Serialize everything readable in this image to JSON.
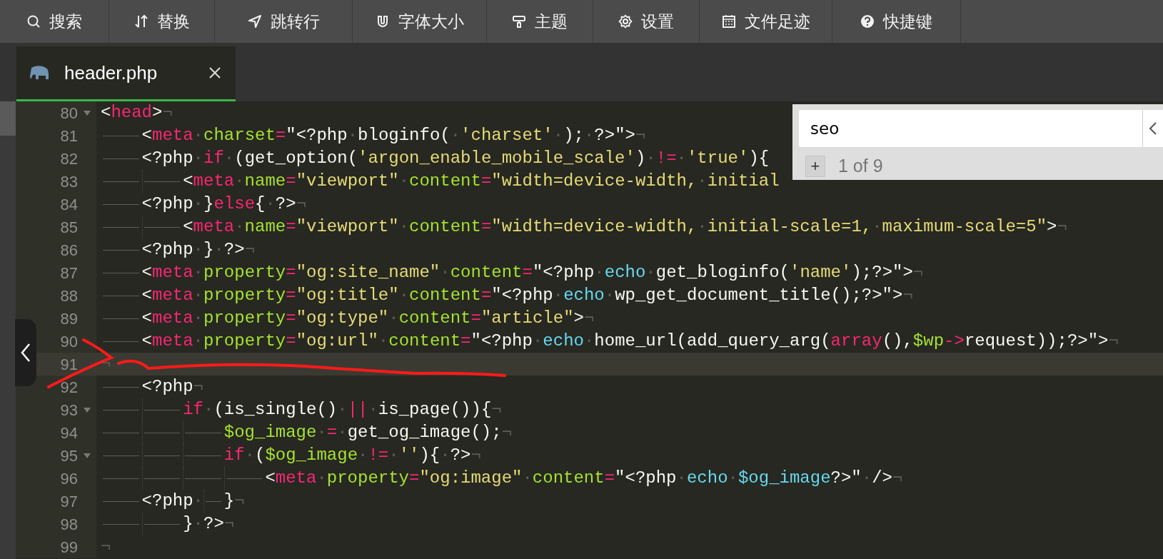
{
  "toolbar": [
    {
      "label": "搜索"
    },
    {
      "label": "替换"
    },
    {
      "label": "跳转行"
    },
    {
      "label": "字体大小"
    },
    {
      "label": "主题"
    },
    {
      "label": "设置"
    },
    {
      "label": "文件足迹"
    },
    {
      "label": "快捷键"
    }
  ],
  "tabs": [
    {
      "label": "header.php",
      "selected": true
    }
  ],
  "search_panel": {
    "value": "seo",
    "add_button": "+",
    "match_count": "1 of 9"
  },
  "editor": {
    "lines": [
      {
        "number": "80",
        "foldable": true,
        "active": false,
        "tokens": [
          {
            "kind": "plain",
            "text": "<"
          },
          {
            "kind": "tag",
            "text": "head"
          },
          {
            "kind": "plain",
            "text": ">"
          },
          {
            "kind": "eol",
            "text": "¬"
          }
        ]
      },
      {
        "number": "81",
        "foldable": false,
        "active": false,
        "tokens": [
          {
            "kind": "tab"
          },
          {
            "kind": "plain",
            "text": "<"
          },
          {
            "kind": "tag",
            "text": "meta"
          },
          {
            "kind": "space",
            "text": "·"
          },
          {
            "kind": "attr",
            "text": "charset"
          },
          {
            "kind": "tag",
            "text": "="
          },
          {
            "kind": "plain",
            "text": "\"<?php"
          },
          {
            "kind": "space",
            "text": "·"
          },
          {
            "kind": "plain",
            "text": "bloginfo("
          },
          {
            "kind": "space",
            "text": "·"
          },
          {
            "kind": "string",
            "text": "'charset'"
          },
          {
            "kind": "space",
            "text": "·"
          },
          {
            "kind": "plain",
            "text": ");"
          },
          {
            "kind": "space",
            "text": "·"
          },
          {
            "kind": "plain",
            "text": "?>\">"
          },
          {
            "kind": "eol",
            "text": "¬"
          }
        ]
      },
      {
        "number": "82",
        "foldable": false,
        "active": false,
        "tokens": [
          {
            "kind": "tab"
          },
          {
            "kind": "plain",
            "text": "<?php"
          },
          {
            "kind": "space",
            "text": "·"
          },
          {
            "kind": "tag",
            "text": "if"
          },
          {
            "kind": "space",
            "text": "·"
          },
          {
            "kind": "plain",
            "text": "(get_option("
          },
          {
            "kind": "string",
            "text": "'argon_enable_mobile_scale'"
          },
          {
            "kind": "plain",
            "text": ")"
          },
          {
            "kind": "space",
            "text": "·"
          },
          {
            "kind": "tag",
            "text": "!="
          },
          {
            "kind": "space",
            "text": "·"
          },
          {
            "kind": "string",
            "text": "'true'"
          },
          {
            "kind": "plain",
            "text": "){"
          }
        ]
      },
      {
        "number": "83",
        "foldable": false,
        "active": false,
        "tokens": [
          {
            "kind": "tab"
          },
          {
            "kind": "tab"
          },
          {
            "kind": "plain",
            "text": "<"
          },
          {
            "kind": "tag",
            "text": "meta"
          },
          {
            "kind": "space",
            "text": "·"
          },
          {
            "kind": "attr",
            "text": "name"
          },
          {
            "kind": "tag",
            "text": "="
          },
          {
            "kind": "string",
            "text": "\"viewport\""
          },
          {
            "kind": "space",
            "text": "·"
          },
          {
            "kind": "attr",
            "text": "content"
          },
          {
            "kind": "tag",
            "text": "="
          },
          {
            "kind": "string",
            "text": "\"width=device-width,"
          },
          {
            "kind": "space",
            "text": "·"
          },
          {
            "kind": "string",
            "text": "initial"
          }
        ]
      },
      {
        "number": "84",
        "foldable": false,
        "active": false,
        "tokens": [
          {
            "kind": "tab"
          },
          {
            "kind": "plain",
            "text": "<?php"
          },
          {
            "kind": "space",
            "text": "·"
          },
          {
            "kind": "plain",
            "text": "}"
          },
          {
            "kind": "tag",
            "text": "else"
          },
          {
            "kind": "plain",
            "text": "{"
          },
          {
            "kind": "space",
            "text": "·"
          },
          {
            "kind": "plain",
            "text": "?>"
          },
          {
            "kind": "eol",
            "text": "¬"
          }
        ]
      },
      {
        "number": "85",
        "foldable": false,
        "active": false,
        "tokens": [
          {
            "kind": "tab"
          },
          {
            "kind": "tab"
          },
          {
            "kind": "plain",
            "text": "<"
          },
          {
            "kind": "tag",
            "text": "meta"
          },
          {
            "kind": "space",
            "text": "·"
          },
          {
            "kind": "attr",
            "text": "name"
          },
          {
            "kind": "tag",
            "text": "="
          },
          {
            "kind": "string",
            "text": "\"viewport\""
          },
          {
            "kind": "space",
            "text": "·"
          },
          {
            "kind": "attr",
            "text": "content"
          },
          {
            "kind": "tag",
            "text": "="
          },
          {
            "kind": "string",
            "text": "\"width=device-width,"
          },
          {
            "kind": "space",
            "text": "·"
          },
          {
            "kind": "string",
            "text": "initial-scale=1,"
          },
          {
            "kind": "space",
            "text": "·"
          },
          {
            "kind": "string",
            "text": "maximum-scale=5\""
          },
          {
            "kind": "plain",
            "text": ">"
          },
          {
            "kind": "eol",
            "text": "¬"
          }
        ]
      },
      {
        "number": "86",
        "foldable": false,
        "active": false,
        "tokens": [
          {
            "kind": "tab"
          },
          {
            "kind": "plain",
            "text": "<?php"
          },
          {
            "kind": "space",
            "text": "·"
          },
          {
            "kind": "plain",
            "text": "}"
          },
          {
            "kind": "space",
            "text": "·"
          },
          {
            "kind": "plain",
            "text": "?>"
          },
          {
            "kind": "eol",
            "text": "¬"
          }
        ]
      },
      {
        "number": "87",
        "foldable": false,
        "active": false,
        "tokens": [
          {
            "kind": "tab"
          },
          {
            "kind": "plain",
            "text": "<"
          },
          {
            "kind": "tag",
            "text": "meta"
          },
          {
            "kind": "space",
            "text": "·"
          },
          {
            "kind": "attr",
            "text": "property"
          },
          {
            "kind": "tag",
            "text": "="
          },
          {
            "kind": "string",
            "text": "\"og:site_name\""
          },
          {
            "kind": "space",
            "text": "·"
          },
          {
            "kind": "attr",
            "text": "content"
          },
          {
            "kind": "tag",
            "text": "="
          },
          {
            "kind": "plain",
            "text": "\"<?php"
          },
          {
            "kind": "space",
            "text": "·"
          },
          {
            "kind": "call",
            "text": "echo"
          },
          {
            "kind": "space",
            "text": "·"
          },
          {
            "kind": "plain",
            "text": "get_bloginfo("
          },
          {
            "kind": "string",
            "text": "'name'"
          },
          {
            "kind": "plain",
            "text": ");?>\">"
          },
          {
            "kind": "eol",
            "text": "¬"
          }
        ]
      },
      {
        "number": "88",
        "foldable": false,
        "active": false,
        "tokens": [
          {
            "kind": "tab"
          },
          {
            "kind": "plain",
            "text": "<"
          },
          {
            "kind": "tag",
            "text": "meta"
          },
          {
            "kind": "space",
            "text": "·"
          },
          {
            "kind": "attr",
            "text": "property"
          },
          {
            "kind": "tag",
            "text": "="
          },
          {
            "kind": "string",
            "text": "\"og:title\""
          },
          {
            "kind": "space",
            "text": "·"
          },
          {
            "kind": "attr",
            "text": "content"
          },
          {
            "kind": "tag",
            "text": "="
          },
          {
            "kind": "plain",
            "text": "\"<?php"
          },
          {
            "kind": "space",
            "text": "·"
          },
          {
            "kind": "call",
            "text": "echo"
          },
          {
            "kind": "space",
            "text": "·"
          },
          {
            "kind": "plain",
            "text": "wp_get_document_title();?>\">"
          },
          {
            "kind": "eol",
            "text": "¬"
          }
        ]
      },
      {
        "number": "89",
        "foldable": false,
        "active": false,
        "tokens": [
          {
            "kind": "tab"
          },
          {
            "kind": "plain",
            "text": "<"
          },
          {
            "kind": "tag",
            "text": "meta"
          },
          {
            "kind": "space",
            "text": "·"
          },
          {
            "kind": "attr",
            "text": "property"
          },
          {
            "kind": "tag",
            "text": "="
          },
          {
            "kind": "string",
            "text": "\"og:type\""
          },
          {
            "kind": "space",
            "text": "·"
          },
          {
            "kind": "attr",
            "text": "content"
          },
          {
            "kind": "tag",
            "text": "="
          },
          {
            "kind": "string",
            "text": "\"article\""
          },
          {
            "kind": "plain",
            "text": ">"
          },
          {
            "kind": "eol",
            "text": "¬"
          }
        ]
      },
      {
        "number": "90",
        "foldable": false,
        "active": false,
        "tokens": [
          {
            "kind": "tab"
          },
          {
            "kind": "plain",
            "text": "<"
          },
          {
            "kind": "tag",
            "text": "meta"
          },
          {
            "kind": "space",
            "text": "·"
          },
          {
            "kind": "attr",
            "text": "property"
          },
          {
            "kind": "tag",
            "text": "="
          },
          {
            "kind": "string",
            "text": "\"og:url\""
          },
          {
            "kind": "space",
            "text": "·"
          },
          {
            "kind": "attr",
            "text": "content"
          },
          {
            "kind": "tag",
            "text": "="
          },
          {
            "kind": "plain",
            "text": "\"<?php"
          },
          {
            "kind": "space",
            "text": "·"
          },
          {
            "kind": "call",
            "text": "echo"
          },
          {
            "kind": "space",
            "text": "·"
          },
          {
            "kind": "plain",
            "text": "home_url(add_query_arg("
          },
          {
            "kind": "tag",
            "text": "array"
          },
          {
            "kind": "plain",
            "text": "(),"
          },
          {
            "kind": "attr",
            "text": "$wp"
          },
          {
            "kind": "tag",
            "text": "->"
          },
          {
            "kind": "plain",
            "text": "request));?>\">"
          },
          {
            "kind": "eol",
            "text": "¬"
          }
        ]
      },
      {
        "number": "91",
        "foldable": false,
        "active": true,
        "tokens": [
          {
            "kind": "eol",
            "text": "¬"
          }
        ]
      },
      {
        "number": "92",
        "foldable": false,
        "active": false,
        "tokens": [
          {
            "kind": "tab"
          },
          {
            "kind": "plain",
            "text": "<?php"
          },
          {
            "kind": "eol",
            "text": "¬"
          }
        ]
      },
      {
        "number": "93",
        "foldable": true,
        "active": false,
        "tokens": [
          {
            "kind": "tab"
          },
          {
            "kind": "tab"
          },
          {
            "kind": "tag",
            "text": "if"
          },
          {
            "kind": "space",
            "text": "·"
          },
          {
            "kind": "plain",
            "text": "(is_single()"
          },
          {
            "kind": "space",
            "text": "·"
          },
          {
            "kind": "tag",
            "text": "||"
          },
          {
            "kind": "space",
            "text": "·"
          },
          {
            "kind": "plain",
            "text": "is_page()){"
          },
          {
            "kind": "eol",
            "text": "¬"
          }
        ]
      },
      {
        "number": "94",
        "foldable": false,
        "active": false,
        "tokens": [
          {
            "kind": "tab"
          },
          {
            "kind": "tab"
          },
          {
            "kind": "tab"
          },
          {
            "kind": "attr",
            "text": "$og_image"
          },
          {
            "kind": "space",
            "text": "·"
          },
          {
            "kind": "tag",
            "text": "="
          },
          {
            "kind": "space",
            "text": "·"
          },
          {
            "kind": "plain",
            "text": "get_og_image();"
          },
          {
            "kind": "eol",
            "text": "¬"
          }
        ]
      },
      {
        "number": "95",
        "foldable": true,
        "active": false,
        "tokens": [
          {
            "kind": "tab"
          },
          {
            "kind": "tab"
          },
          {
            "kind": "tab"
          },
          {
            "kind": "tag",
            "text": "if"
          },
          {
            "kind": "space",
            "text": "·"
          },
          {
            "kind": "plain",
            "text": "("
          },
          {
            "kind": "attr",
            "text": "$og_image"
          },
          {
            "kind": "space",
            "text": "·"
          },
          {
            "kind": "tag",
            "text": "!="
          },
          {
            "kind": "space",
            "text": "·"
          },
          {
            "kind": "string",
            "text": "''"
          },
          {
            "kind": "plain",
            "text": "){"
          },
          {
            "kind": "space",
            "text": "·"
          },
          {
            "kind": "plain",
            "text": "?>"
          },
          {
            "kind": "eol",
            "text": "¬"
          }
        ]
      },
      {
        "number": "96",
        "foldable": false,
        "active": false,
        "tokens": [
          {
            "kind": "tab"
          },
          {
            "kind": "tab"
          },
          {
            "kind": "tab"
          },
          {
            "kind": "tab"
          },
          {
            "kind": "plain",
            "text": "<"
          },
          {
            "kind": "tag",
            "text": "meta"
          },
          {
            "kind": "space",
            "text": "·"
          },
          {
            "kind": "attr",
            "text": "property"
          },
          {
            "kind": "tag",
            "text": "="
          },
          {
            "kind": "string",
            "text": "\"og:image\""
          },
          {
            "kind": "space",
            "text": "·"
          },
          {
            "kind": "attr",
            "text": "content"
          },
          {
            "kind": "tag",
            "text": "="
          },
          {
            "kind": "plain",
            "text": "\"<?php"
          },
          {
            "kind": "space",
            "text": "·"
          },
          {
            "kind": "call",
            "text": "echo"
          },
          {
            "kind": "space",
            "text": "·"
          },
          {
            "kind": "call",
            "text": "$og_image"
          },
          {
            "kind": "plain",
            "text": "?>\""
          },
          {
            "kind": "space",
            "text": "·"
          },
          {
            "kind": "plain",
            "text": "/>"
          },
          {
            "kind": "eol",
            "text": "¬"
          }
        ]
      },
      {
        "number": "97",
        "foldable": false,
        "active": false,
        "tokens": [
          {
            "kind": "tab"
          },
          {
            "kind": "plain",
            "text": "<?php"
          },
          {
            "kind": "space",
            "text": "·"
          },
          {
            "kind": "tab"
          },
          {
            "kind": "plain",
            "text": "}"
          },
          {
            "kind": "eol",
            "text": "¬"
          }
        ]
      },
      {
        "number": "98",
        "foldable": false,
        "active": false,
        "tokens": [
          {
            "kind": "tab"
          },
          {
            "kind": "tab"
          },
          {
            "kind": "plain",
            "text": "}"
          },
          {
            "kind": "space",
            "text": "·"
          },
          {
            "kind": "plain",
            "text": "?>"
          },
          {
            "kind": "eol",
            "text": "¬"
          }
        ]
      },
      {
        "number": "99",
        "foldable": false,
        "active": false,
        "tokens": [
          {
            "kind": "eol",
            "text": "¬"
          }
        ]
      }
    ]
  }
}
